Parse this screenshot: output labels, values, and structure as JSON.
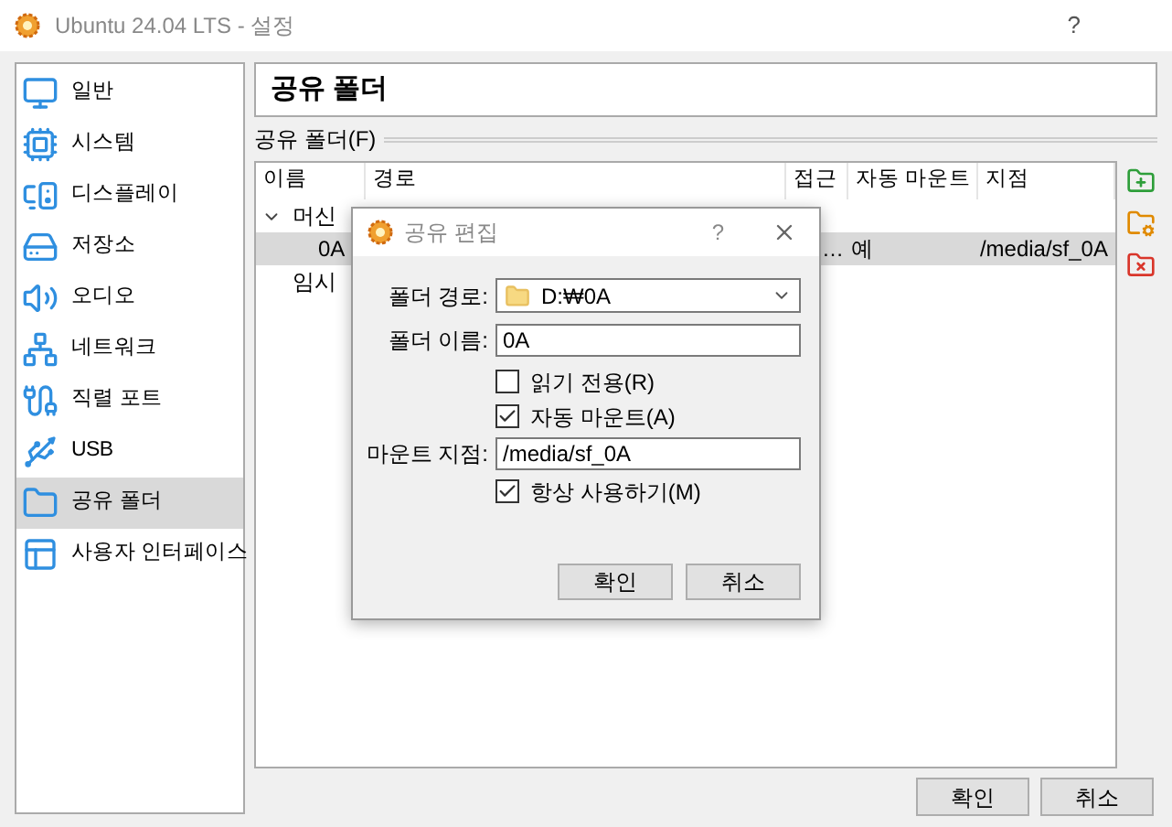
{
  "window": {
    "title": "Ubuntu 24.04 LTS - 설정",
    "help": "?"
  },
  "sidebar": {
    "items": [
      {
        "kind": "general",
        "label": "일반",
        "selected": false
      },
      {
        "kind": "system",
        "label": "시스템",
        "selected": false
      },
      {
        "kind": "display",
        "label": "디스플레이",
        "selected": false
      },
      {
        "kind": "storage",
        "label": "저장소",
        "selected": false
      },
      {
        "kind": "audio",
        "label": "오디오",
        "selected": false
      },
      {
        "kind": "network",
        "label": "네트워크",
        "selected": false
      },
      {
        "kind": "serial",
        "label": "직렬 포트",
        "selected": false
      },
      {
        "kind": "usb",
        "label": "USB",
        "selected": false
      },
      {
        "kind": "shared",
        "label": "공유 폴더",
        "selected": true
      },
      {
        "kind": "ui",
        "label": "사용자 인터페이스",
        "selected": false
      }
    ]
  },
  "page_title": "공유 폴더",
  "section_label": "공유 폴더(F)",
  "table": {
    "columns": [
      "이름",
      "경로",
      "접근",
      "자동 마운트",
      "지점"
    ],
    "groups": [
      {
        "label": "머신",
        "expanded": true,
        "rows": [
          {
            "name": "0A",
            "access": "…",
            "auto_mount": "예",
            "point": "/media/sf_0A",
            "selected": true
          }
        ]
      },
      {
        "label": "임시"
      }
    ]
  },
  "toolbar": [
    {
      "kind": "add"
    },
    {
      "kind": "edit"
    },
    {
      "kind": "remove"
    }
  ],
  "dialog": {
    "title": "공유 편집",
    "help": "?",
    "folder_path_label": "폴더 경로:",
    "folder_path": "D:₩0A",
    "folder_name_label": "폴더 이름:",
    "folder_name": "0A",
    "checks": [
      {
        "label": "읽기 전용(R)",
        "checked": false
      },
      {
        "label": "자동 마운트(A)",
        "checked": true
      }
    ],
    "mount_point_label": "마운트 지점:",
    "mount_point": "/media/sf_0A",
    "permanent": {
      "label": "항상 사용하기(M)",
      "checked": true
    },
    "buttons": [
      "확인",
      "취소"
    ]
  },
  "buttons": [
    "확인",
    "취소"
  ]
}
